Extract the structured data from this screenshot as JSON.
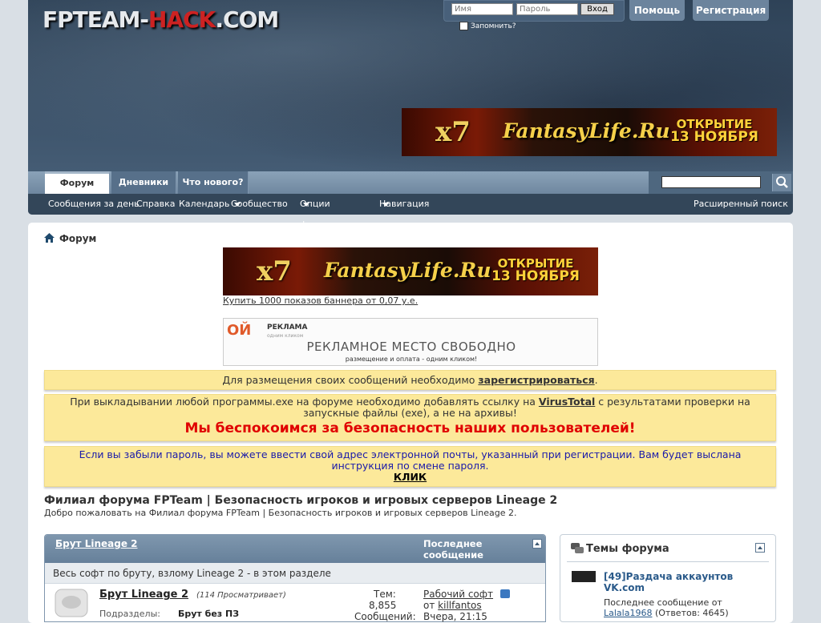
{
  "header": {
    "logo_main": "FPTEAM-",
    "logo_red": "HACK",
    "logo_end": ".COM",
    "username_placeholder": "Имя",
    "password_placeholder": "Пароль",
    "login_button": "Вход",
    "remember_label": "Запомнить?",
    "help_tab": "Помощь",
    "register_tab": "Регистрация"
  },
  "banner": {
    "multiplier": "x7",
    "brand": "FantasyLife.Ru",
    "opening_line1": "ОТКРЫТИЕ",
    "opening_line2": "13 НОЯБРЯ"
  },
  "nav": {
    "tabs": [
      {
        "label": "Форум",
        "active": true
      },
      {
        "label": "Дневники",
        "active": false
      },
      {
        "label": "Что нового?",
        "active": false
      }
    ],
    "subnav": [
      "Сообщения за день",
      "Справка",
      "Календарь",
      "Сообщество",
      "Опции форума",
      "Навигация"
    ],
    "advanced_search": "Расширенный поиск"
  },
  "breadcrumb": "Форум",
  "ads": {
    "buy_link": "Купить 1000 показов баннера от 0,07 у.е.",
    "ad_logo": "ОЙ",
    "ad_brand": "РЕКЛАМА",
    "ad_brand_sub": "одним кликом",
    "ad_free_text": "РЕКЛАМНОЕ МЕСТО СВОБОДНО",
    "ad_sub": "размещение и оплата - одним кликом!"
  },
  "notices": {
    "register_pre": "Для размещения своих сообщений необходимо ",
    "register_link": "зарегистрироваться",
    "register_post": ".",
    "virus_pre": "При выкладывании любой программы.exe на форуме необходимо добавлять ссылку на ",
    "virus_link": "VirusTotal",
    "virus_post": " с результатами проверки на запускные файлы (exe), а не на архивы!",
    "security": "Мы беспокоимся за безопасность наших пользователей!",
    "password_text": "Если вы забыли пароль, вы можете ввести свой адрес электронной почты, указанный при регистрации. Вам будет выслана инструкция по смене пароля.",
    "click": "КЛИК"
  },
  "forum": {
    "title": "Филиал форума FPTeam | Безопасность игроков и игровых серверов Lineage 2",
    "welcome": "Добро пожаловать на Филиал форума FPTeam | Безопасность игроков и игровых серверов Lineage 2.",
    "category": "Брут Lineage 2",
    "last_post_header": "Последнее сообщение",
    "category_desc": "Весь софт по бруту, взлому Lineage 2 - в этом разделе",
    "subforum_title": "Брут Lineage 2",
    "subforum_viewing": "(114 Просматривает)",
    "threads_label": "Тем:",
    "threads_value": "8,855",
    "posts_label": "Сообщений:",
    "last_thread": "Рабочий софт",
    "by_label": "от",
    "last_author": "killfantos",
    "last_time": "Вчера, 21:15",
    "subforums_label": "Подразделы:",
    "subforum_child": "Брут без ПЗ"
  },
  "sidebar": {
    "title": "Темы форума",
    "thread_title": "[49]Раздача аккаунтов VK.com",
    "last_post_label": "Последнее сообщение от",
    "last_author": "Lalala1968",
    "replies": "(Ответов: 4645)"
  }
}
